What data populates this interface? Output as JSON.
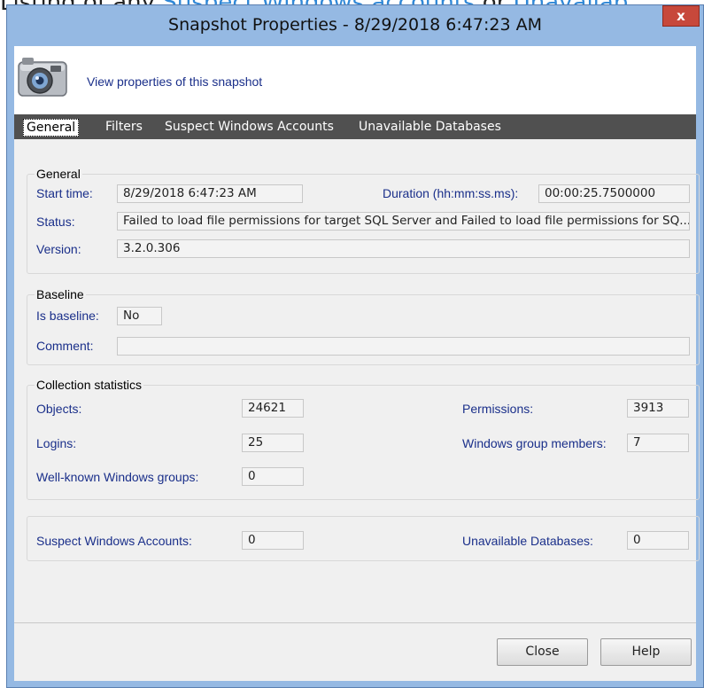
{
  "background": {
    "prefix": "Listing of any ",
    "link1": "Suspect Windows accounts",
    "middle": " or ",
    "link2": "Unavailab"
  },
  "window": {
    "title": "Snapshot Properties - 8/29/2018 6:47:23 AM",
    "close_label": "x"
  },
  "header": {
    "text": "View properties of this snapshot",
    "icon": "camera-icon"
  },
  "tabs": [
    {
      "label": "General",
      "active": true
    },
    {
      "label": "Filters",
      "active": false
    },
    {
      "label": "Suspect Windows Accounts",
      "active": false
    },
    {
      "label": "Unavailable Databases",
      "active": false
    }
  ],
  "general": {
    "title": "General",
    "start_time_label": "Start time:",
    "start_time": "8/29/2018 6:47:23 AM",
    "duration_label": "Duration (hh:mm:ss.ms):",
    "duration": "00:00:25.7500000",
    "status_label": "Status:",
    "status": "Failed to load file permissions for target SQL Server and Failed to load file permissions for SQ...",
    "version_label": "Version:",
    "version": "3.2.0.306"
  },
  "baseline": {
    "title": "Baseline",
    "is_baseline_label": "Is baseline:",
    "is_baseline": "No",
    "comment_label": "Comment:",
    "comment": ""
  },
  "stats": {
    "title": "Collection statistics",
    "objects_label": "Objects:",
    "objects": "24621",
    "permissions_label": "Permissions:",
    "permissions": "3913",
    "logins_label": "Logins:",
    "logins": "25",
    "wgm_label": "Windows group members:",
    "wgm": "7",
    "wkg_label": "Well-known Windows groups:",
    "wkg": "0"
  },
  "accounts": {
    "suspect_label": "Suspect Windows Accounts:",
    "suspect": "0",
    "unavailable_label": "Unavailable Databases:",
    "unavailable": "0"
  },
  "buttons": {
    "close": "Close",
    "help": "Help"
  }
}
